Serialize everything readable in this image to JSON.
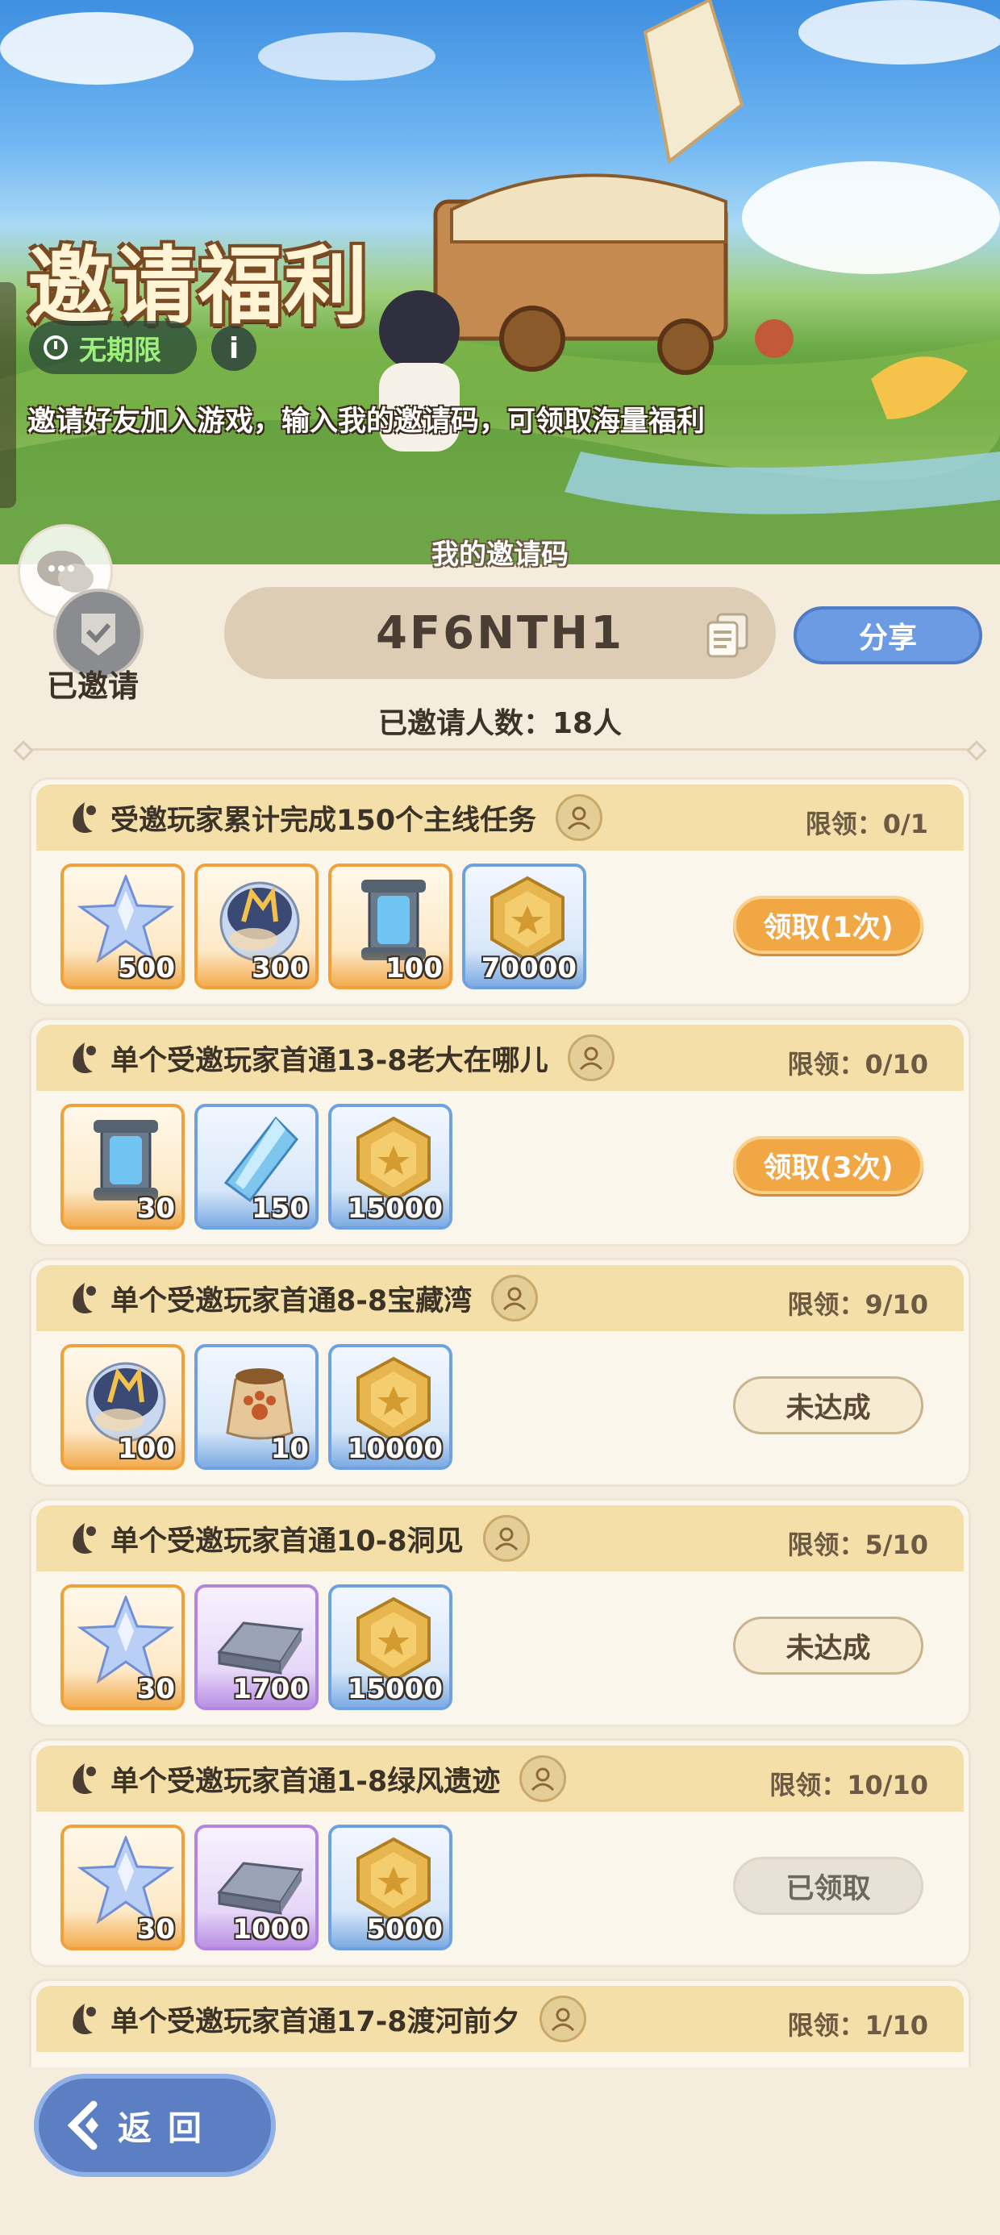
{
  "banner": {
    "title": "邀请福利",
    "limit_label": "无期限",
    "info_icon": "i",
    "subtitle": "邀请好友加入游戏，输入我的邀请码，可领取海量福利"
  },
  "invite": {
    "invited_label": "已邀请",
    "code_title": "我的邀请码",
    "code": "4F6NTH1",
    "share_label": "分享",
    "count_text": "已邀请人数：18人"
  },
  "colors": {
    "accent_orange": "#f2a745",
    "accent_blue": "#6a9be3",
    "header_bg": "#f4dfa9",
    "page_bg": "#f4ecdc"
  },
  "tasks": [
    {
      "name": "受邀玩家累计完成150个主线任务",
      "limit": "限领：0/1",
      "action": "领取(1次)",
      "state": "claim",
      "rewards": [
        {
          "icon": "star-crystal-icon",
          "amount": "500",
          "rarity": "orange"
        },
        {
          "icon": "egg-orb-icon",
          "amount": "300",
          "rarity": "orange"
        },
        {
          "icon": "energy-canister-icon",
          "amount": "100",
          "rarity": "orange"
        },
        {
          "icon": "gold-coin-icon",
          "amount": "70000",
          "rarity": "blue"
        }
      ]
    },
    {
      "name": "单个受邀玩家首通13-8老大在哪儿",
      "limit": "限领：0/10",
      "action": "领取(3次)",
      "state": "claim",
      "rewards": [
        {
          "icon": "energy-canister-icon",
          "amount": "30",
          "rarity": "orange"
        },
        {
          "icon": "blue-crystal-icon",
          "amount": "150",
          "rarity": "blue"
        },
        {
          "icon": "gold-coin-icon",
          "amount": "15000",
          "rarity": "blue"
        }
      ]
    },
    {
      "name": "单个受邀玩家首通8-8宝藏湾",
      "limit": "限领：9/10",
      "action": "未达成",
      "state": "pending",
      "rewards": [
        {
          "icon": "egg-orb-icon",
          "amount": "100",
          "rarity": "orange"
        },
        {
          "icon": "pet-food-bag-icon",
          "amount": "10",
          "rarity": "blue"
        },
        {
          "icon": "gold-coin-icon",
          "amount": "10000",
          "rarity": "blue"
        }
      ]
    },
    {
      "name": "单个受邀玩家首通10-8洞见",
      "limit": "限领：5/10",
      "action": "未达成",
      "state": "pending",
      "rewards": [
        {
          "icon": "star-crystal-icon",
          "amount": "30",
          "rarity": "orange"
        },
        {
          "icon": "iron-ingot-icon",
          "amount": "1700",
          "rarity": "purple"
        },
        {
          "icon": "gold-coin-icon",
          "amount": "15000",
          "rarity": "blue"
        }
      ]
    },
    {
      "name": "单个受邀玩家首通1-8绿风遗迹",
      "limit": "限领：10/10",
      "action": "已领取",
      "state": "done",
      "rewards": [
        {
          "icon": "star-crystal-icon",
          "amount": "30",
          "rarity": "orange"
        },
        {
          "icon": "iron-ingot-icon",
          "amount": "1000",
          "rarity": "purple"
        },
        {
          "icon": "gold-coin-icon",
          "amount": "5000",
          "rarity": "blue"
        }
      ]
    },
    {
      "name": "单个受邀玩家首通17-8渡河前夕",
      "limit": "限领：1/10",
      "action": "",
      "state": "claim",
      "rewards": []
    }
  ],
  "back": {
    "label": "返回"
  }
}
